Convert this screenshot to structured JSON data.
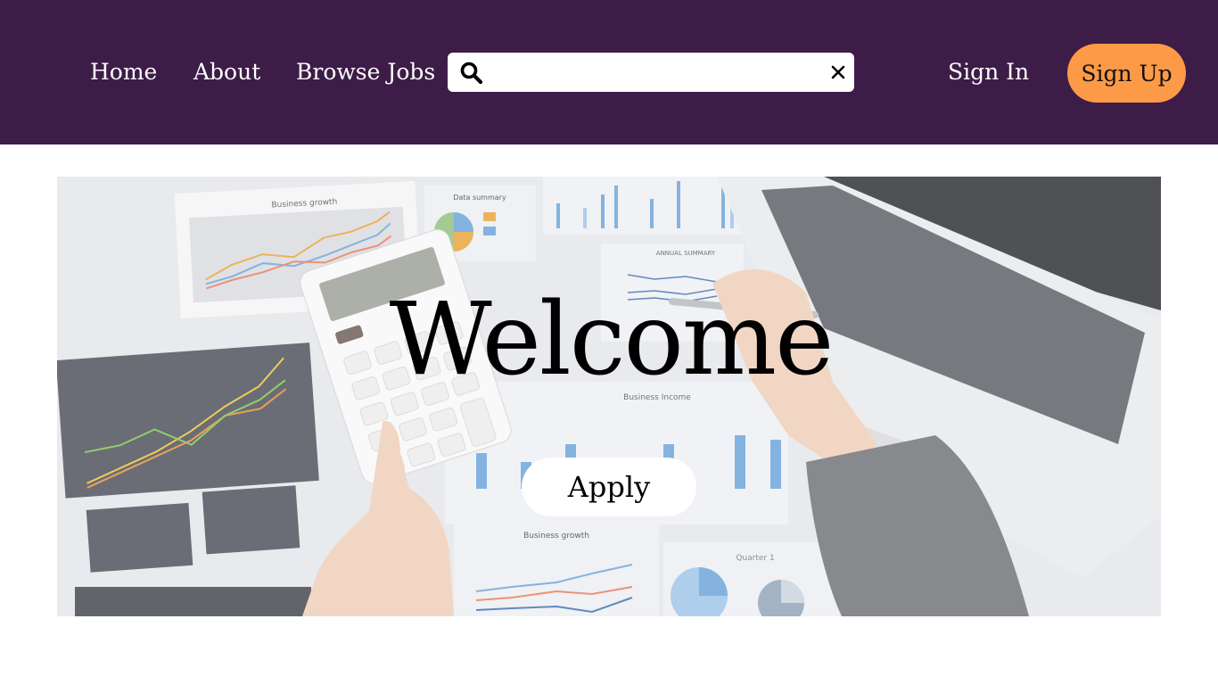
{
  "nav": {
    "links": [
      {
        "label": "Home"
      },
      {
        "label": "About"
      },
      {
        "label": "Browse Jobs"
      }
    ],
    "search": {
      "value": "",
      "placeholder": ""
    },
    "sign_in": "Sign In",
    "sign_up": "Sign Up"
  },
  "hero": {
    "title": "Welcome",
    "apply_label": "Apply",
    "background_image": {
      "chart_titles": [
        "Business growth",
        "Data summary",
        "ANNUAL SUMMARY",
        "Business Income",
        "Business growth",
        "Quarter 1"
      ]
    }
  },
  "colors": {
    "navbar": "#3d1c47",
    "sign_up_button": "#fd9a47",
    "nav_text": "#ffffff",
    "apply_button": "#ffffff"
  }
}
